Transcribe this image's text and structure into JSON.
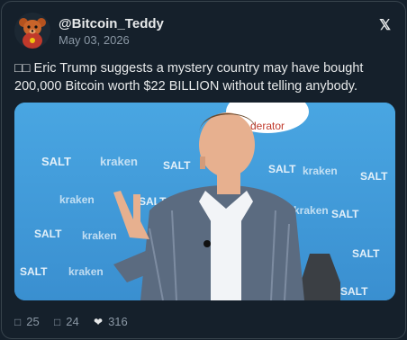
{
  "post": {
    "username": "@Bitcoin_Teddy",
    "date": "May 03, 2026",
    "text_line1": "□□ Eric Trump suggests a mystery country may have bought",
    "text_line2": "200,000 Bitcoin worth $22 BILLION without telling anybody.",
    "x_logo": "𝕏"
  },
  "media": {
    "backdrop_words": [
      "SALT",
      "kraken",
      "SALT",
      "SALT",
      "kraken",
      "SALT",
      "kraken",
      "SALT",
      "kraken",
      "SALT",
      "SALT",
      "kraken",
      "SALT",
      "SALT",
      "kraken",
      "SALT"
    ],
    "sign_text": "derator"
  },
  "stats": {
    "replies_icon": "□",
    "replies": "25",
    "reposts_icon": "□",
    "reposts": "24",
    "likes_icon": "❤",
    "likes": "316"
  },
  "colors": {
    "background": "#15202b",
    "border": "#38444d",
    "muted": "#8b98a5",
    "backdrop_blue": "#3b9ad9"
  }
}
